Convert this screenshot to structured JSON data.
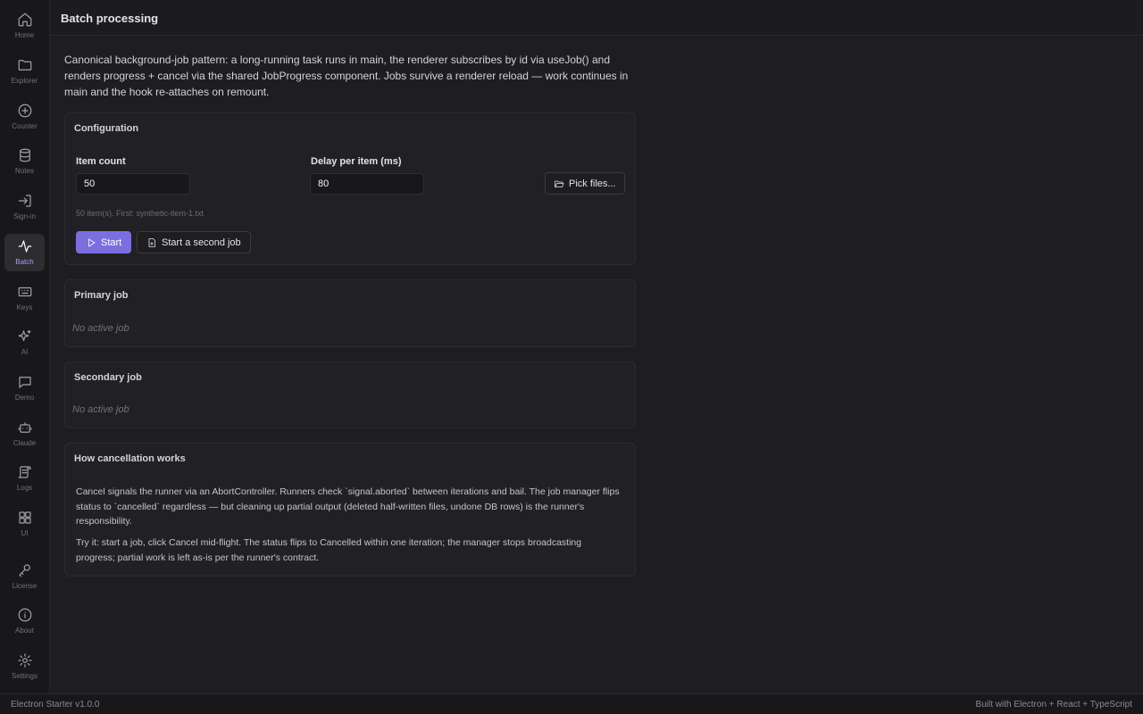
{
  "sidebar": {
    "items": [
      {
        "label": "Home",
        "icon": "home-icon"
      },
      {
        "label": "Explorer",
        "icon": "folder-icon"
      },
      {
        "label": "Counter",
        "icon": "plus-circle-icon"
      },
      {
        "label": "Notes",
        "icon": "database-icon"
      },
      {
        "label": "Sign-in",
        "icon": "sign-in-icon"
      },
      {
        "label": "Batch",
        "icon": "activity-icon",
        "active": true
      },
      {
        "label": "Keys",
        "icon": "keyboard-icon"
      },
      {
        "label": "AI",
        "icon": "sparkles-icon"
      },
      {
        "label": "Demo",
        "icon": "message-icon"
      },
      {
        "label": "Claude",
        "icon": "bot-icon"
      },
      {
        "label": "Logs",
        "icon": "scroll-icon"
      },
      {
        "label": "UI",
        "icon": "grid-icon"
      },
      {
        "label": "License",
        "icon": "key-icon"
      },
      {
        "label": "About",
        "icon": "info-icon"
      },
      {
        "label": "Settings",
        "icon": "gear-icon"
      }
    ]
  },
  "header": {
    "title": "Batch processing"
  },
  "intro": "Canonical background-job pattern: a long-running task runs in main, the renderer subscribes by id via useJob() and renders progress + cancel via the shared JobProgress component. Jobs survive a renderer reload — work continues in main and the hook re-attaches on remount.",
  "config": {
    "title": "Configuration",
    "item_count_label": "Item count",
    "item_count_value": "50",
    "delay_label": "Delay per item (ms)",
    "delay_value": "80",
    "pick_files_label": "Pick files...",
    "hint": "50 item(s). First: synthetic-item-1.txt",
    "start_label": "Start",
    "start_second_label": "Start a second job"
  },
  "primary": {
    "title": "Primary job",
    "empty": "No active job"
  },
  "secondary": {
    "title": "Secondary job",
    "empty": "No active job"
  },
  "cancellation": {
    "title": "How cancellation works",
    "p1": "Cancel signals the runner via an AbortController. Runners check `signal.aborted` between iterations and bail. The job manager flips status to `cancelled` regardless — but cleaning up partial output (deleted half-written files, undone DB rows) is the runner's responsibility.",
    "p2": "Try it: start a job, click Cancel mid-flight. The status flips to Cancelled within one iteration; the manager stops broadcasting progress; partial work is left as-is per the runner's contract."
  },
  "footer": {
    "left": "Electron Starter v1.0.0",
    "right": "Built with Electron + React + TypeScript"
  },
  "colors": {
    "accent": "#7b6fe0",
    "background": "#1e1e21",
    "sidebar": "#18181b"
  }
}
